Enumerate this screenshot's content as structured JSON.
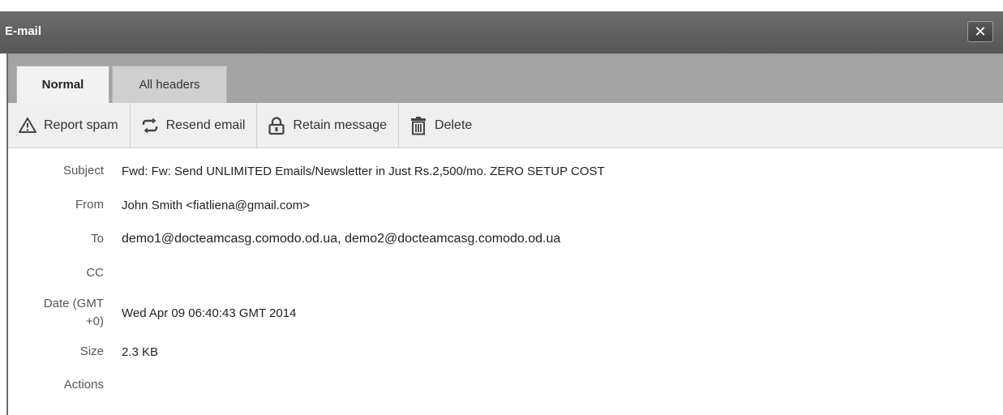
{
  "window": {
    "title": "E-mail",
    "close_label": "✕"
  },
  "tabs": [
    {
      "label": "Normal",
      "active": true
    },
    {
      "label": "All headers",
      "active": false
    }
  ],
  "toolbar": {
    "report_spam": "Report spam",
    "resend_email": "Resend email",
    "retain_message": "Retain message",
    "delete": "Delete"
  },
  "details": {
    "subject_label": "Subject",
    "subject": "Fwd: Fw: Send UNLIMITED Emails/Newsletter in Just Rs.2,500/mo. ZERO SETUP COST",
    "from_label": "From",
    "from": "John Smith <fiatliena@gmail.com>",
    "to_label": "To",
    "to": "demo1@docteamcasg.comodo.od.ua, demo2@docteamcasg.comodo.od.ua",
    "cc_label": "CC",
    "cc": "",
    "date_label_line1": "Date (GMT",
    "date_label_line2": "+0)",
    "date": "Wed Apr 09 06:40:43 GMT 2014",
    "size_label": "Size",
    "size": "2.3 KB",
    "actions_label": "Actions"
  }
}
